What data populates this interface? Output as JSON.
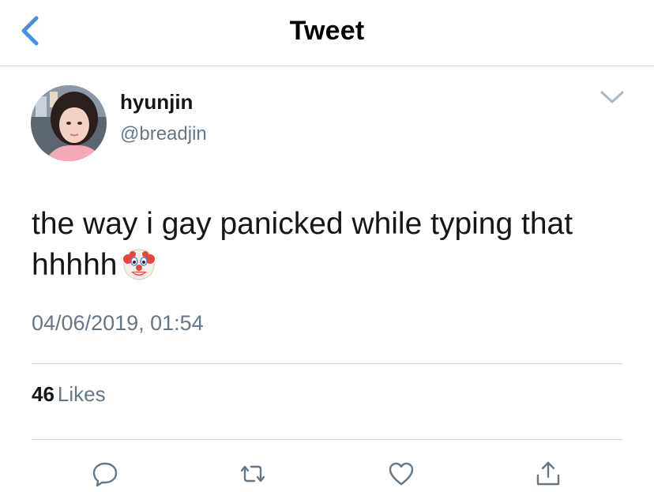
{
  "nav": {
    "title": "Tweet",
    "back_icon": "chevron-left-icon",
    "accent": "#4a90e2"
  },
  "author": {
    "name": "hyunjin",
    "handle": "@breadjin"
  },
  "tweet": {
    "text": "the way i gay panicked while typing that hhhhh",
    "emoji": "clown-face-emoji",
    "timestamp": "04/06/2019, 01:54"
  },
  "stats": {
    "likes_count": "46",
    "likes_label": "Likes"
  },
  "actions": [
    "reply-icon",
    "retweet-icon",
    "like-icon",
    "share-icon"
  ],
  "colors": {
    "text": "#14171a",
    "secondary": "#657786",
    "divider": "#d8d8d8"
  }
}
